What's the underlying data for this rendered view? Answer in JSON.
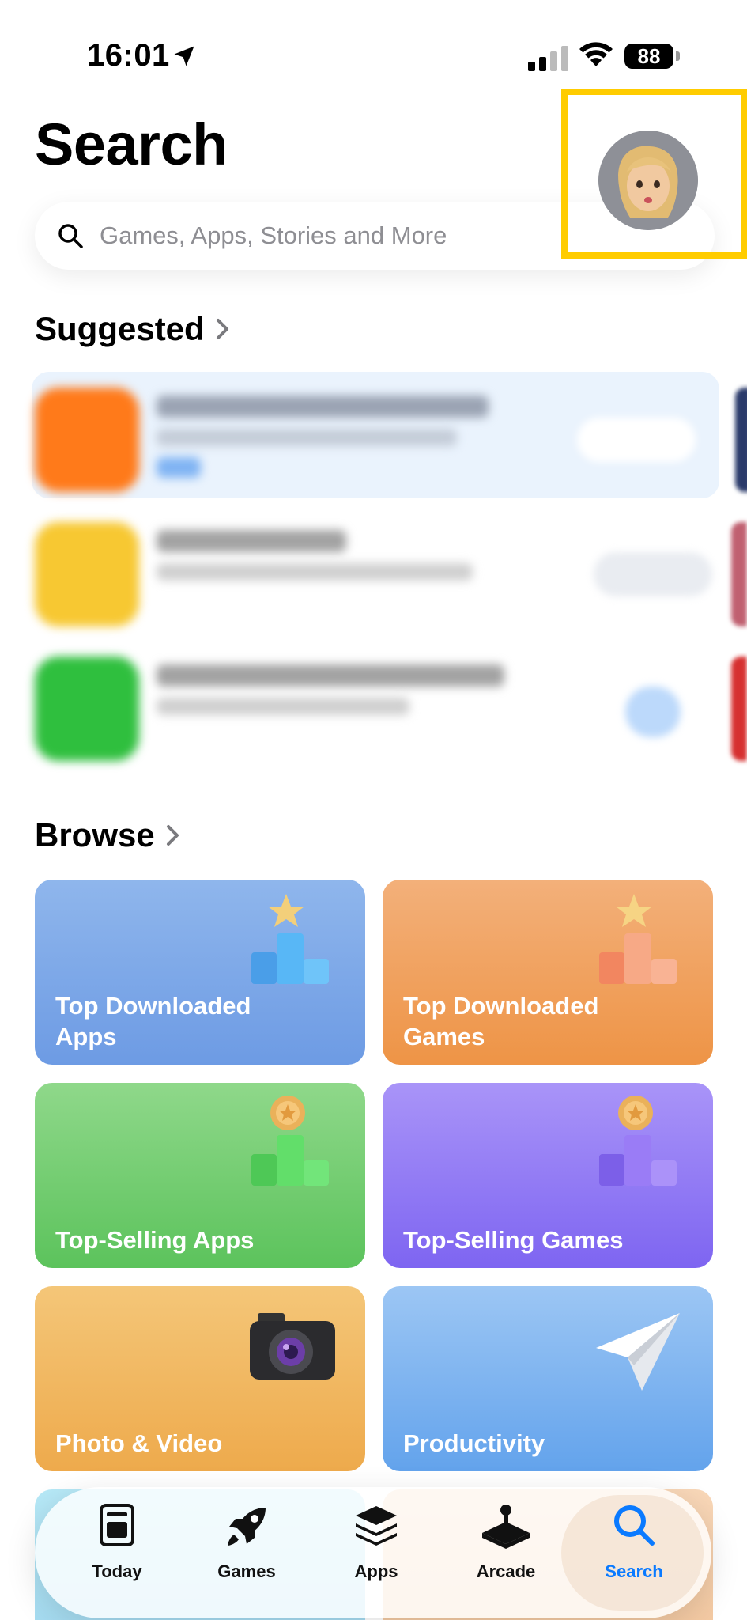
{
  "status_bar": {
    "time": "16:01",
    "battery": "88"
  },
  "header": {
    "title": "Search"
  },
  "search": {
    "placeholder": "Games, Apps, Stories and More"
  },
  "suggested": {
    "heading": "Suggested"
  },
  "browse": {
    "heading": "Browse",
    "tiles": [
      {
        "label": "Top Downloaded Apps",
        "line1": "Top Downloaded",
        "line2": "Apps",
        "color": "#6f9ee8"
      },
      {
        "label": "Top Downloaded Games",
        "line1": "Top Downloaded",
        "line2": "Games",
        "color": "#f0994f"
      },
      {
        "label": "Top-Selling Apps",
        "line1": "Top-Selling Apps",
        "line2": "",
        "color": "#5cc35c"
      },
      {
        "label": "Top-Selling Games",
        "line1": "Top-Selling Games",
        "line2": "",
        "color": "#8a6ff4"
      },
      {
        "label": "Photo & Video",
        "line1": "Photo & Video",
        "line2": "",
        "color": "#f0b458"
      },
      {
        "label": "Productivity",
        "line1": "Productivity",
        "line2": "",
        "color": "#6aa8ee"
      }
    ]
  },
  "tab_bar": {
    "tabs": [
      {
        "label": "Today",
        "icon": "today-icon"
      },
      {
        "label": "Games",
        "icon": "rocket-icon"
      },
      {
        "label": "Apps",
        "icon": "layers-icon"
      },
      {
        "label": "Arcade",
        "icon": "joystick-icon"
      },
      {
        "label": "Search",
        "icon": "search-icon",
        "active": true
      }
    ],
    "active_color": "#0a7aff"
  },
  "highlight_color": "#ffcc00"
}
